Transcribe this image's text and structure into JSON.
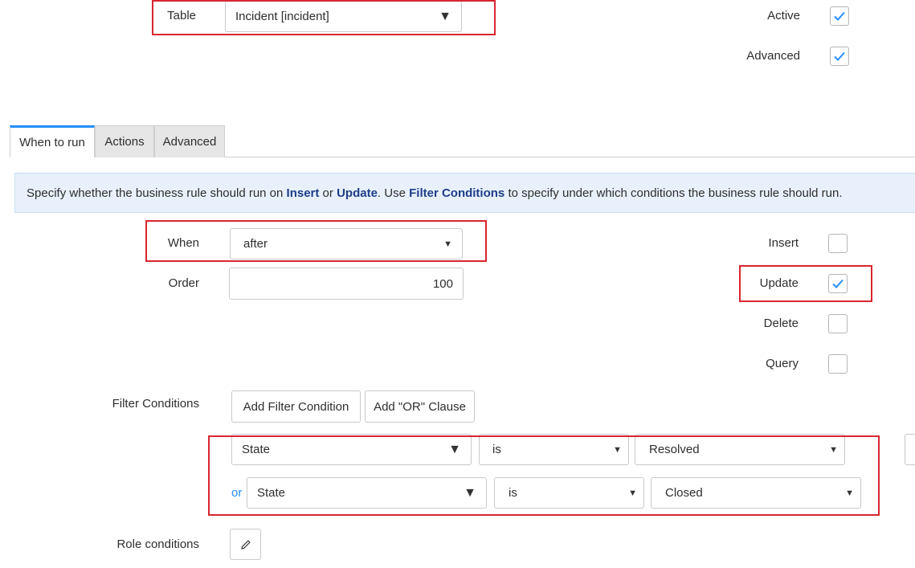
{
  "top": {
    "table_label": "Table",
    "table_value": "Incident [incident]",
    "active_label": "Active",
    "active_checked": true,
    "advanced_label": "Advanced",
    "advanced_checked": true
  },
  "tabs": [
    {
      "label": "When to run",
      "active": true
    },
    {
      "label": "Actions",
      "active": false
    },
    {
      "label": "Advanced",
      "active": false
    }
  ],
  "info": {
    "text_1": "Specify whether the business rule should run on ",
    "insert": "Insert",
    "text_2": " or ",
    "update": "Update",
    "text_3": ". Use ",
    "filter_conditions": "Filter Conditions",
    "text_4": " to specify under which conditions the business rule should run."
  },
  "form": {
    "when_label": "When",
    "when_value": "after",
    "order_label": "Order",
    "order_value": "100",
    "insert_label": "Insert",
    "insert_checked": false,
    "update_label": "Update",
    "update_checked": true,
    "delete_label": "Delete",
    "delete_checked": false,
    "query_label": "Query",
    "query_checked": false
  },
  "filter": {
    "label": "Filter Conditions",
    "add_condition": "Add Filter Condition",
    "add_or": "Add \"OR\" Clause",
    "or_text": "or",
    "rows": [
      {
        "field": "State",
        "operator": "is",
        "value": "Resolved"
      },
      {
        "field": "State",
        "operator": "is",
        "value": "Closed"
      }
    ]
  },
  "role": {
    "label": "Role conditions"
  },
  "colors": {
    "accent": "#278efc",
    "highlight": "#d9262f",
    "info_bg": "#e8f1fb",
    "link": "#1f3d8a"
  }
}
